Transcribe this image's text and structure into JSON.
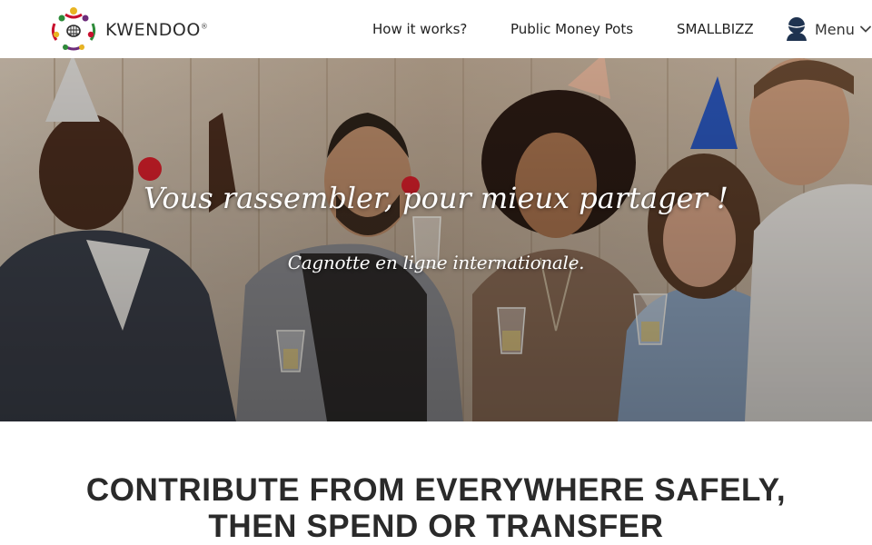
{
  "header": {
    "logo": {
      "text": "KWENDOO",
      "reg": "®"
    },
    "nav": {
      "how_it_works": "How it works?",
      "public_money_pots": "Public Money Pots",
      "smallbizz": "SMALLBIZZ"
    },
    "menu_label": "Menu",
    "icons": {
      "account": "user-avatar-icon",
      "menu_toggle": "chevron-down-icon"
    }
  },
  "hero": {
    "title": "Vous rassembler, pour mieux partager !",
    "subtitle": "Cagnotte en ligne internationale."
  },
  "main": {
    "headline": "CONTRIBUTE FROM EVERYWHERE SAFELY, THEN SPEND OR TRANSFER"
  },
  "colors": {
    "brand_dark": "#2b2b2b",
    "logo_red": "#c8102e",
    "logo_green": "#2e8b3a",
    "logo_yellow": "#e8b422",
    "logo_purple": "#6d2c7a",
    "hero_text": "#ffffff",
    "user_icon": "#1f3350"
  }
}
